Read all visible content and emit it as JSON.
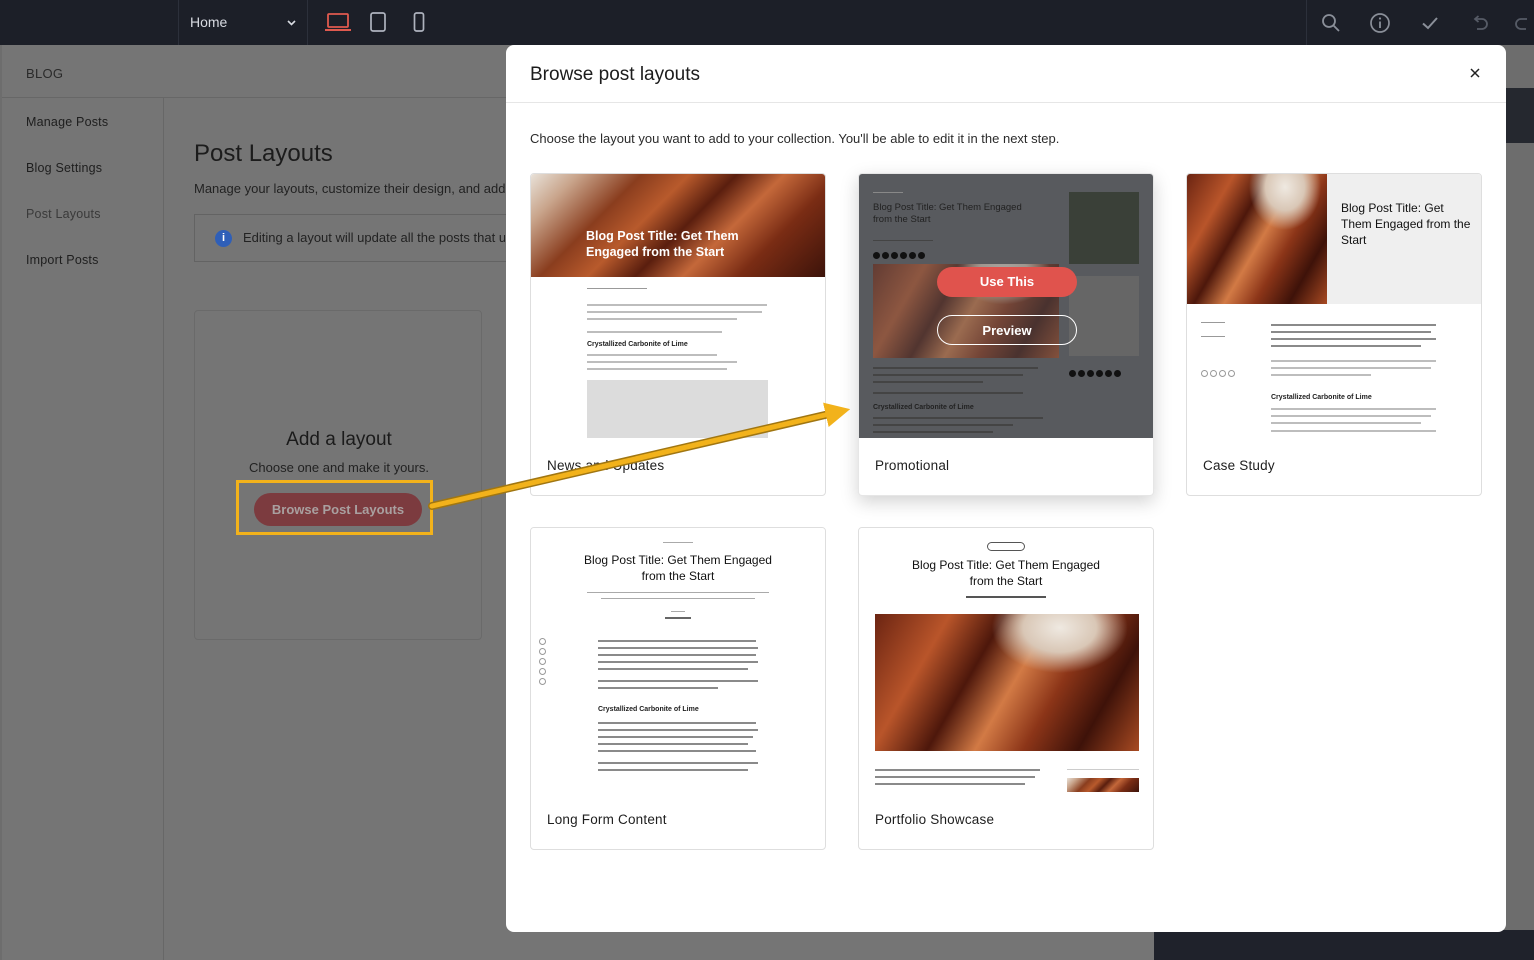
{
  "topbar": {
    "page_selector": "Home",
    "devices": [
      "desktop-icon",
      "tablet-icon",
      "mobile-icon"
    ],
    "right_icons": [
      "search-icon",
      "info-icon",
      "check-icon",
      "undo-icon",
      "redo-icon"
    ],
    "accent": "#e05a4f"
  },
  "editor": {
    "section_title": "BLOG",
    "nav": [
      "Manage Posts",
      "Blog Settings",
      "Post Layouts",
      "Import Posts"
    ],
    "page_title": "Post Layouts",
    "page_subtitle": "Manage your layouts, customize their design, and add",
    "info_text": "Editing a layout will update all the posts that u",
    "add_card": {
      "title": "Add a layout",
      "subtitle": "Choose one and make it yours.",
      "button": "Browse Post Layouts"
    }
  },
  "modal": {
    "title": "Browse post layouts",
    "description": "Choose the layout you want to add to your collection. You'll be able to edit it in the next step.",
    "use_this": "Use This",
    "preview": "Preview",
    "layouts": [
      {
        "name": "News and Updates",
        "thumb_title": "Blog Post Title: Get Them Engaged from the Start",
        "section": "Crystallized Carbonite of Lime"
      },
      {
        "name": "Promotional",
        "thumb_title": "Blog Post Title: Get Them Engaged from the Start",
        "section": "Crystallized Carbonite of Lime"
      },
      {
        "name": "Case Study",
        "thumb_title": "Blog Post Title: Get Them Engaged from the Start",
        "section": "Crystallized Carbonite of Lime"
      },
      {
        "name": "Long Form Content",
        "thumb_title": "Blog Post Title: Get Them Engaged from the Start",
        "section": "Crystallized Carbonite of Lime"
      },
      {
        "name": "Portfolio Showcase",
        "thumb_title": "Blog Post Title: Get Them Engaged from the Start",
        "section": ""
      }
    ]
  },
  "annotation": {
    "highlight_color": "#f2b21b"
  }
}
